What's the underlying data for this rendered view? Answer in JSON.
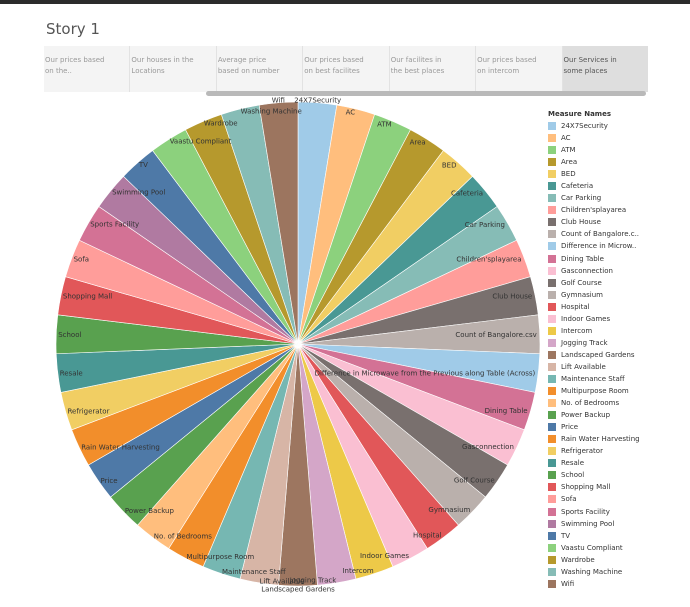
{
  "story": {
    "title": "Story 1",
    "tabs": [
      {
        "label": "Our prices based on the..",
        "active": false
      },
      {
        "label": "Our houses in the Locations",
        "active": false
      },
      {
        "label": "Average price based on number",
        "active": false
      },
      {
        "label": "Our prices based on best facilites",
        "active": false
      },
      {
        "label": "Our facilites in the best places",
        "active": false
      },
      {
        "label": "Our prices based on intercom",
        "active": false
      },
      {
        "label": "Our Services in some places",
        "active": true
      }
    ]
  },
  "chart_data": {
    "type": "pie",
    "legend_title": "Measure Names",
    "legend_position": "right",
    "slices": [
      {
        "name": "24X7Security",
        "value": 1,
        "color": "#a0cbe8"
      },
      {
        "name": "AC",
        "value": 1,
        "color": "#ffbe7d"
      },
      {
        "name": "ATM",
        "value": 1,
        "color": "#8cd17d"
      },
      {
        "name": "Area",
        "value": 1,
        "color": "#b6992d"
      },
      {
        "name": "BED",
        "value": 1,
        "color": "#f1ce63"
      },
      {
        "name": "Cafeteria",
        "value": 1,
        "color": "#499894"
      },
      {
        "name": "Car Parking",
        "value": 1,
        "color": "#86bcb6"
      },
      {
        "name": "Children'splayarea",
        "value": 1,
        "color": "#ff9d9a"
      },
      {
        "name": "Club House",
        "value": 1,
        "color": "#79706e"
      },
      {
        "name": "Count of Bangalore.csv",
        "legend": "Count of Bangalore.c..",
        "value": 1,
        "color": "#bab0ac"
      },
      {
        "name": "Difference in Microwave from the Previous along Table (Across)",
        "legend": "Difference in Microw..",
        "value": 1,
        "color": "#a0cbe8"
      },
      {
        "name": "Dining Table",
        "value": 1,
        "color": "#d37295"
      },
      {
        "name": "Gasconnection",
        "value": 1,
        "color": "#fabfd2"
      },
      {
        "name": "Golf Course",
        "value": 1,
        "color": "#79706e"
      },
      {
        "name": "Gymnasium",
        "value": 1,
        "color": "#bab0ac"
      },
      {
        "name": "Hospital",
        "value": 1,
        "color": "#e15759"
      },
      {
        "name": "Indoor Games",
        "value": 1,
        "color": "#fabfd2"
      },
      {
        "name": "Intercom",
        "value": 1,
        "color": "#edc948"
      },
      {
        "name": "Jogging Track",
        "value": 1,
        "color": "#d4a6c8"
      },
      {
        "name": "Landscaped Gardens",
        "value": 1,
        "color": "#9d7660"
      },
      {
        "name": "Lift Available",
        "value": 1,
        "color": "#d7b5a6"
      },
      {
        "name": "Maintenance Staff",
        "value": 1,
        "color": "#76b7b2"
      },
      {
        "name": "Multipurpose Room",
        "value": 1,
        "color": "#f28e2b"
      },
      {
        "name": "No. of Bedrooms",
        "value": 1,
        "color": "#ffbe7d"
      },
      {
        "name": "Power Backup",
        "value": 1,
        "color": "#59a14f"
      },
      {
        "name": "Price",
        "value": 1,
        "color": "#4e79a7"
      },
      {
        "name": "Rain Water Harvesting",
        "value": 1,
        "color": "#f28e2b"
      },
      {
        "name": "Refrigerator",
        "value": 1,
        "color": "#f1ce63"
      },
      {
        "name": "Resale",
        "value": 1,
        "color": "#499894"
      },
      {
        "name": "School",
        "value": 1,
        "color": "#59a14f"
      },
      {
        "name": "Shopping Mall",
        "value": 1,
        "color": "#e15759"
      },
      {
        "name": "Sofa",
        "value": 1,
        "color": "#ff9d9a"
      },
      {
        "name": "Sports Facility",
        "value": 1,
        "color": "#d37295"
      },
      {
        "name": "Swimming Pool",
        "value": 1,
        "color": "#b07aa1"
      },
      {
        "name": "TV",
        "value": 1,
        "color": "#4e79a7"
      },
      {
        "name": "Vaastu Compliant",
        "value": 1,
        "color": "#8cd17d"
      },
      {
        "name": "Wardrobe",
        "value": 1,
        "color": "#b6992d"
      },
      {
        "name": "Washing Machine",
        "value": 1,
        "color": "#86bcb6"
      },
      {
        "name": "Wifi",
        "value": 1,
        "color": "#9c755f"
      }
    ]
  }
}
